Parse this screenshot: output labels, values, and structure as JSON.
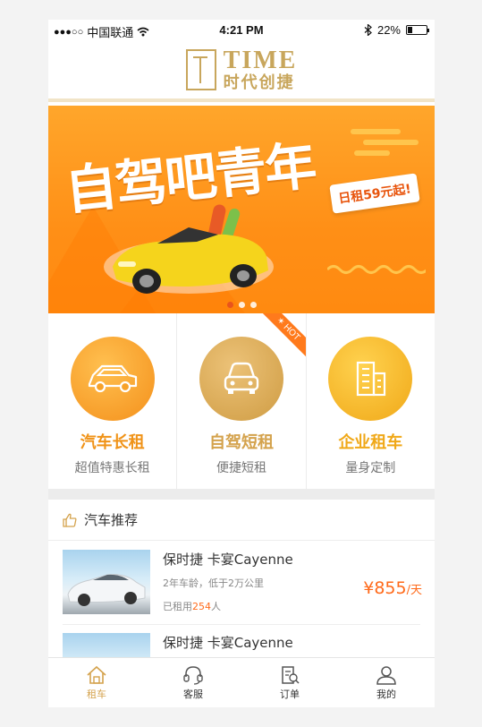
{
  "status_bar": {
    "signal": "●●●○○",
    "carrier": "中国联通",
    "time": "4:21 PM",
    "battery": "22%",
    "battery_level": 0.22
  },
  "header": {
    "logo_en": "TIME",
    "logo_cn": "时代创捷"
  },
  "banner": {
    "title": "自驾吧青年",
    "promo": "日租59元起!",
    "slides": 3,
    "active_slide": 0
  },
  "services": [
    {
      "name": "汽车长租",
      "desc": "超值特惠长租",
      "icon": "car-icon",
      "color": "#f6a223"
    },
    {
      "name": "自驾短租",
      "desc": "便捷短租",
      "icon": "car-front-icon",
      "color": "#d9ad5a",
      "badge": "HOT"
    },
    {
      "name": "企业租车",
      "desc": "量身定制",
      "icon": "building-icon",
      "color": "#f2b41f"
    }
  ],
  "recommend": {
    "title": "汽车推荐",
    "items": [
      {
        "name": "保时捷  卡宴Cayenne",
        "meta": "2年车龄，低于2万公里",
        "rented_prefix": "已租用",
        "rented_count": "254",
        "rented_suffix": "人",
        "price": "¥855",
        "unit": "/天"
      },
      {
        "name": "保时捷  卡宴Cayenne",
        "meta": "",
        "rented_prefix": "",
        "rented_count": "",
        "rented_suffix": "",
        "price": "",
        "unit": ""
      }
    ]
  },
  "tabbar": [
    {
      "label": "租车",
      "icon": "home-icon",
      "active": true
    },
    {
      "label": "客服",
      "icon": "headset-icon",
      "active": false
    },
    {
      "label": "订单",
      "icon": "order-icon",
      "active": false
    },
    {
      "label": "我的",
      "icon": "user-icon",
      "active": false
    }
  ],
  "colors": {
    "accent": "#d4a24c",
    "price": "#ff6a1a",
    "banner": "#ff9a1f"
  }
}
